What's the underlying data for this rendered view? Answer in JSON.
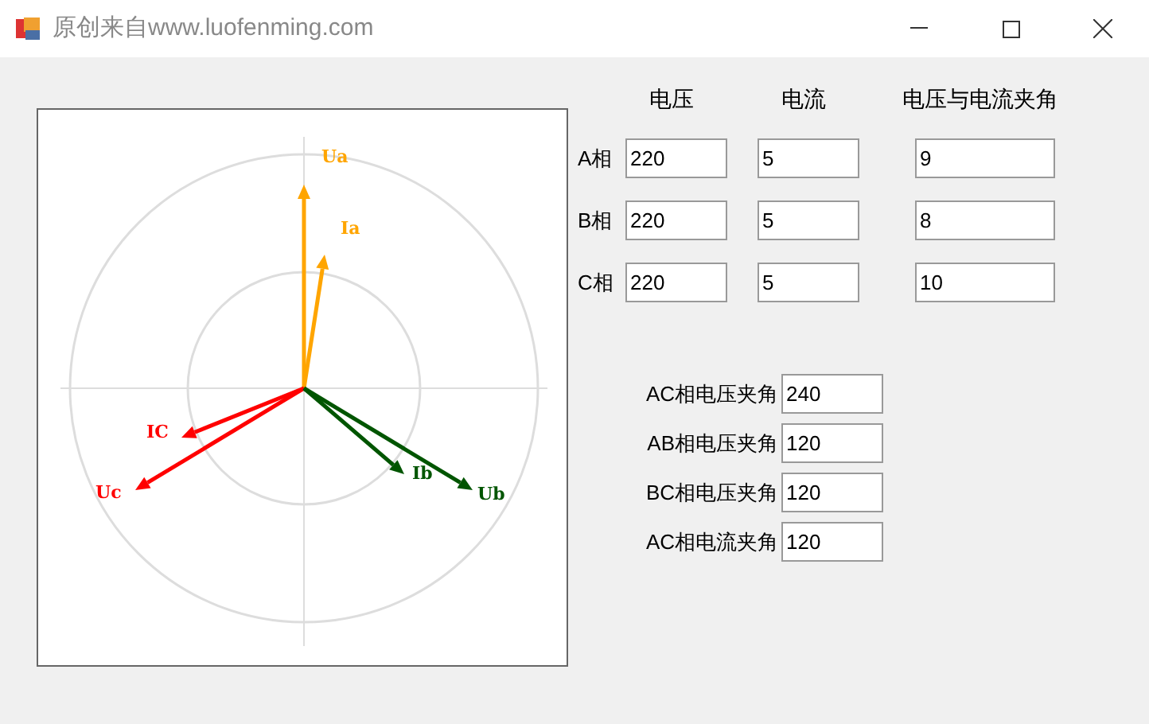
{
  "window": {
    "title": "原创来自www.luofenming.com"
  },
  "phasor_diagram": {
    "vectors": [
      {
        "label": "Ua",
        "color": "#ffa500"
      },
      {
        "label": "Ia",
        "color": "#ffa500"
      },
      {
        "label": "IC",
        "color": "#ff0000"
      },
      {
        "label": "Uc",
        "color": "#ff0000"
      },
      {
        "label": "Ib",
        "color": "#005500"
      },
      {
        "label": "Ub",
        "color": "#005500"
      }
    ]
  },
  "phase_table": {
    "columns": [
      "电压",
      "电流",
      "电压与电流夹角"
    ],
    "rows": [
      {
        "label": "A相",
        "values": [
          "220",
          "5",
          "9"
        ]
      },
      {
        "label": "B相",
        "values": [
          "220",
          "5",
          "8"
        ]
      },
      {
        "label": "C相",
        "values": [
          "220",
          "5",
          "10"
        ]
      }
    ]
  },
  "angles": [
    {
      "label": "AC相电压夹角",
      "value": "240"
    },
    {
      "label": "AB相电压夹角",
      "value": "120"
    },
    {
      "label": "BC相电压夹角",
      "value": "120"
    },
    {
      "label": "AC相电流夹角",
      "value": "120"
    }
  ]
}
